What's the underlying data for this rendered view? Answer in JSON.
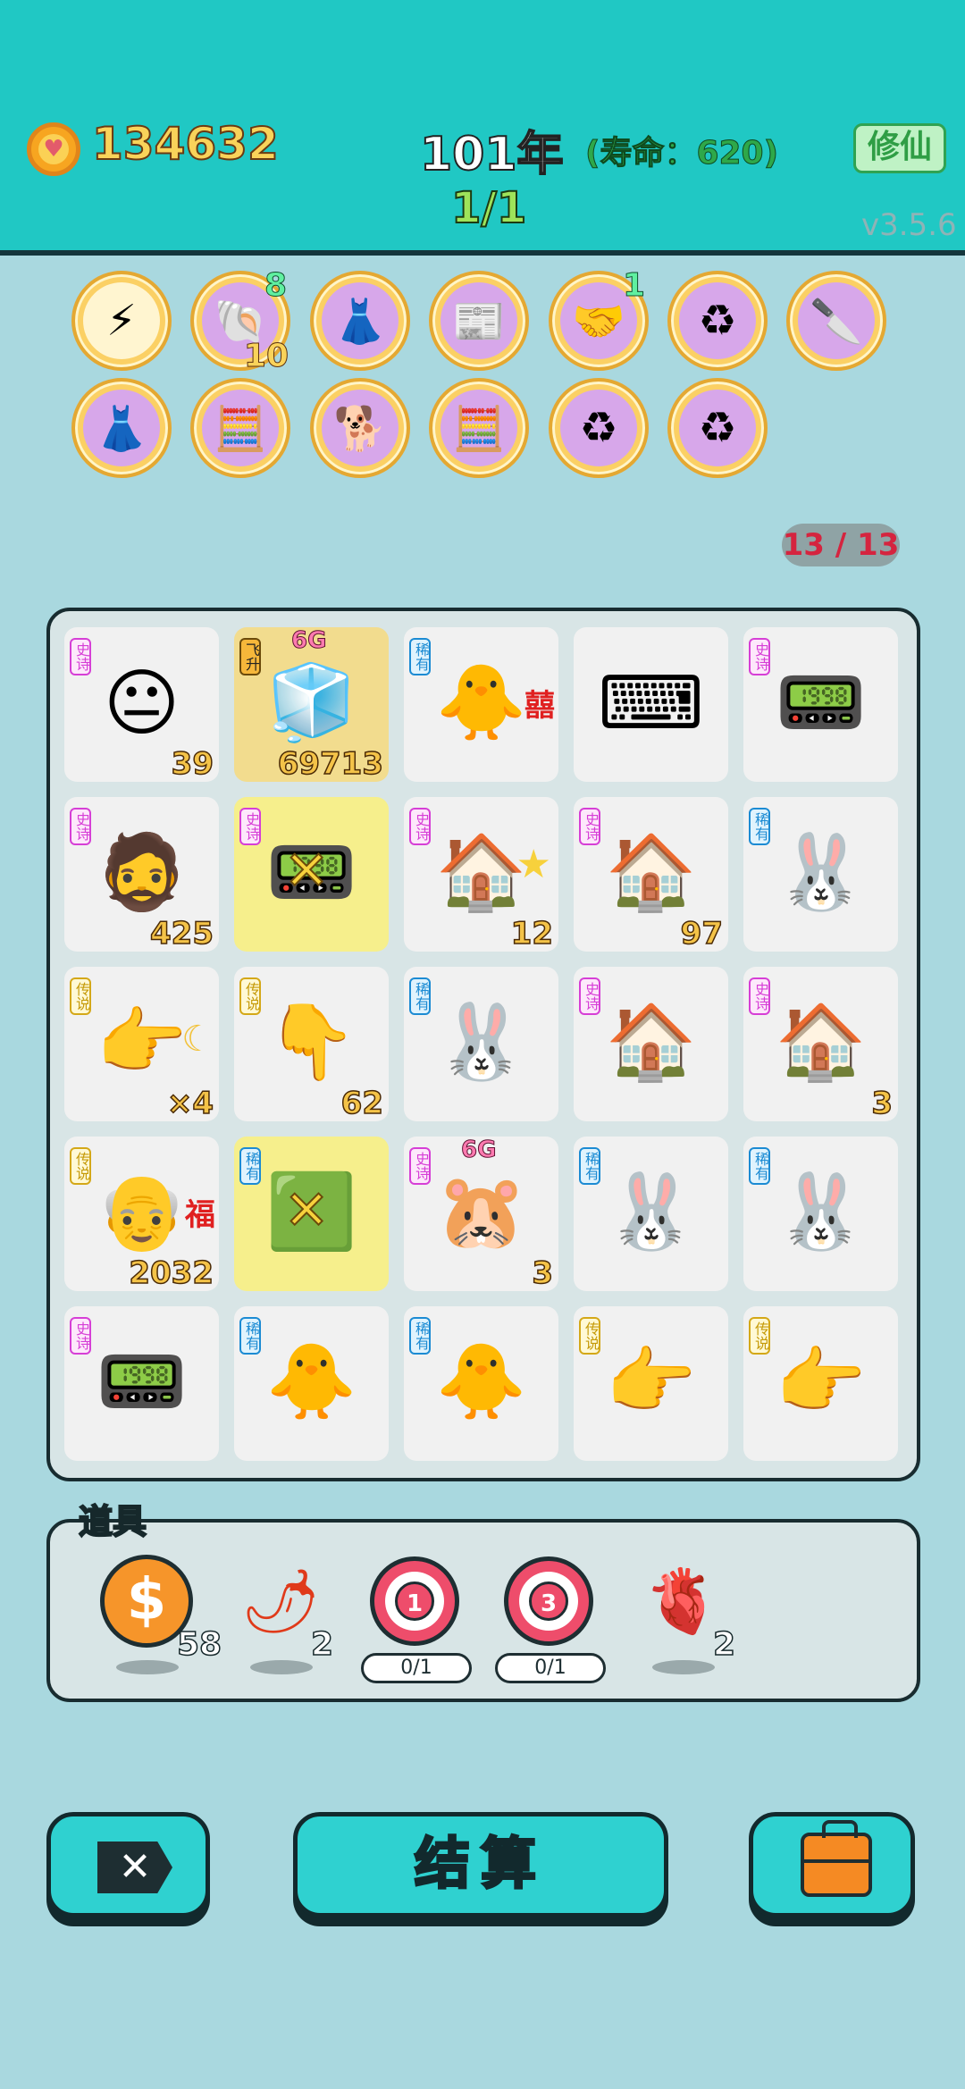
{
  "header": {
    "coins": "134632",
    "year": "101年",
    "lifespan": "(寿命：620)",
    "round": "1/1",
    "cultivate_label": "修仙",
    "version": "v3.5.6"
  },
  "top_items": [
    {
      "icon": "lightning-icon",
      "glyph": "⚡",
      "light": true
    },
    {
      "icon": "shell-icon",
      "glyph": "🐚",
      "badge_top": "8",
      "badge_bottom": "10"
    },
    {
      "icon": "skirt-icon",
      "glyph": "👗"
    },
    {
      "icon": "magazine-icon",
      "glyph": "📰"
    },
    {
      "icon": "handshake-icon",
      "glyph": "🤝",
      "badge_top": "1"
    },
    {
      "icon": "recycle-icon",
      "glyph": "♻"
    },
    {
      "icon": "cleaver-icon",
      "glyph": "🔪"
    },
    {
      "icon": "skirt-icon",
      "glyph": "👗"
    },
    {
      "icon": "hacker-formula-icon",
      "glyph": "🧮"
    },
    {
      "icon": "dogs-icon",
      "glyph": "🐕"
    },
    {
      "icon": "hacker-formula-icon",
      "glyph": "🧮"
    },
    {
      "icon": "recycle-icon",
      "glyph": "♻"
    },
    {
      "icon": "recycle-icon",
      "glyph": "♻"
    }
  ],
  "counter": "13 / 13",
  "grid": [
    {
      "tag": "史诗",
      "tag_type": "shi",
      "icon": "yellow-face-icon",
      "glyph": "😐",
      "count": "39"
    },
    {
      "tag": "飞升",
      "tag_type": "fei",
      "icon": "fridge-icon",
      "glyph": "🧊",
      "count": "69713",
      "g6": "6G",
      "hl": "hl-yellow"
    },
    {
      "tag": "稀有",
      "tag_type": "xi",
      "icon": "chick-double-happiness-icon",
      "glyph": "🐥",
      "extra": "囍"
    },
    {
      "icon": "keyboard-icon",
      "glyph": "⌨"
    },
    {
      "tag": "史诗",
      "tag_type": "shi",
      "icon": "graphics-card-icon",
      "glyph": "📟"
    },
    {
      "tag": "史诗",
      "tag_type": "shi",
      "icon": "green-hair-man-icon",
      "glyph": "🧔",
      "count": "425"
    },
    {
      "tag": "史诗",
      "tag_type": "shi",
      "icon": "graphics-card-crossed-icon",
      "glyph": "📟",
      "hl": "hl-light",
      "cross": true
    },
    {
      "tag": "史诗",
      "tag_type": "shi",
      "icon": "rabbit-house-star-icon",
      "glyph": "🏠",
      "count": "12",
      "star": true
    },
    {
      "tag": "史诗",
      "tag_type": "shi",
      "icon": "rabbit-house-icon",
      "glyph": "🏠",
      "count": "97"
    },
    {
      "tag": "稀有",
      "tag_type": "xi",
      "icon": "rabbit-icon",
      "glyph": "🐰"
    },
    {
      "tag": "传说",
      "tag_type": "chuan",
      "icon": "pointing-hand-moon-icon",
      "glyph": "👉",
      "count": "×4",
      "moon": true
    },
    {
      "tag": "传说",
      "tag_type": "chuan",
      "icon": "pointing-hand-down-icon",
      "glyph": "👇",
      "count": "62"
    },
    {
      "tag": "稀有",
      "tag_type": "xi",
      "icon": "rabbit-icon",
      "glyph": "🐰"
    },
    {
      "tag": "史诗",
      "tag_type": "shi",
      "icon": "rabbit-house-icon",
      "glyph": "🏠"
    },
    {
      "tag": "史诗",
      "tag_type": "shi",
      "icon": "rabbit-house-icon",
      "glyph": "🏠",
      "count": "3"
    },
    {
      "tag": "传说",
      "tag_type": "chuan",
      "icon": "old-man-fortune-icon",
      "glyph": "👴",
      "count": "2032",
      "extra": "福"
    },
    {
      "tag": "稀有",
      "tag_type": "xi",
      "icon": "cpu-crossed-icon",
      "glyph": "🟩",
      "hl": "hl-light",
      "cross": true
    },
    {
      "tag": "史诗",
      "tag_type": "shi",
      "icon": "hamster-icon",
      "glyph": "🐹",
      "count": "3",
      "g6": "6G"
    },
    {
      "tag": "稀有",
      "tag_type": "xi",
      "icon": "rabbit-icon",
      "glyph": "🐰"
    },
    {
      "tag": "稀有",
      "tag_type": "xi",
      "icon": "rabbit-icon",
      "glyph": "🐰"
    },
    {
      "tag": "史诗",
      "tag_type": "shi",
      "icon": "graphics-card-icon",
      "glyph": "📟"
    },
    {
      "tag": "稀有",
      "tag_type": "xi",
      "icon": "chick-icon",
      "glyph": "🐥"
    },
    {
      "tag": "稀有",
      "tag_type": "xi",
      "icon": "chick-icon",
      "glyph": "🐥"
    },
    {
      "tag": "传说",
      "tag_type": "chuan",
      "icon": "pointing-hand-icon",
      "glyph": "👉"
    },
    {
      "tag": "传说",
      "tag_type": "chuan",
      "icon": "pointing-hand-icon",
      "glyph": "👉"
    }
  ],
  "props": {
    "label": "道具",
    "items": [
      {
        "icon": "coin-icon",
        "count": "58"
      },
      {
        "icon": "chili-icon",
        "count": "2"
      },
      {
        "icon": "target-1-icon",
        "num": "1",
        "progress": "0/1"
      },
      {
        "icon": "target-3-icon",
        "num": "3",
        "progress": "0/1"
      },
      {
        "icon": "liver-icon",
        "count": "2"
      }
    ]
  },
  "buttons": {
    "settle_label": "结算"
  },
  "colors": {
    "header": "#20c8c4",
    "background": "#a9d8df",
    "accent_teal": "#2fd1d0",
    "legend_tag": "#c59a08",
    "epic_tag": "#d63fd6",
    "rare_tag": "#1c8bd3"
  }
}
